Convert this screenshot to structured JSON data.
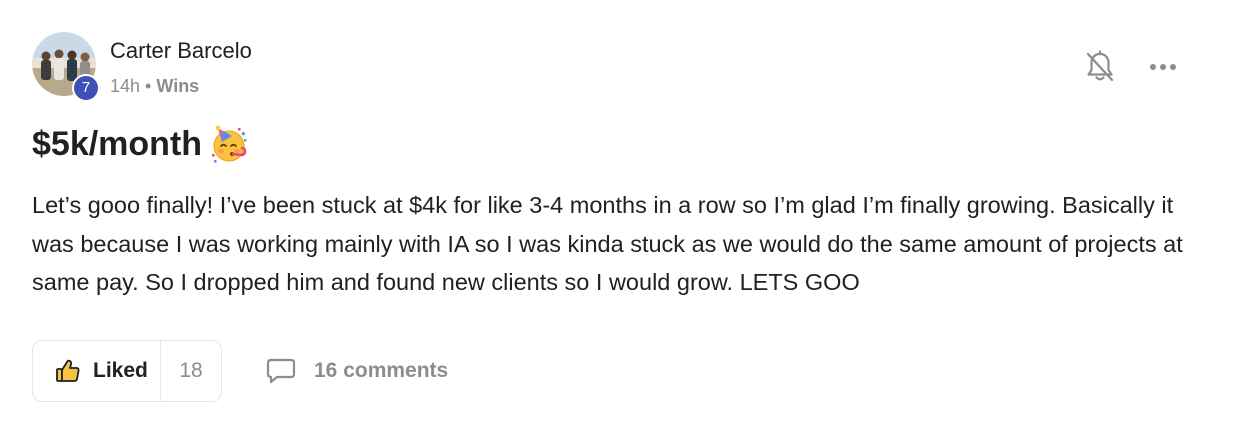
{
  "post": {
    "author": {
      "name": "Carter Barcelo",
      "level": "7"
    },
    "meta": {
      "time": "14h",
      "separator": "•",
      "category": "Wins"
    },
    "title": "$5k/month",
    "title_emoji": "partying-face-icon",
    "body": "Let’s gooo finally! I’ve been stuck at $4k for like 3-4 months in a row so I’m glad I’m finally growing. Basically it was because I was working mainly with IA so I was kinda stuck as we would do the same amount of projects at same pay. So I dropped him and found new clients so I would grow. LETS GOO",
    "actions": {
      "like_label": "Liked",
      "like_count": "18",
      "comments_label": "16 comments"
    }
  },
  "colors": {
    "text": "#202124",
    "muted": "#8a8d91",
    "badge": "#3f51b5",
    "border": "#e4e6e8",
    "like_icon_fill": "#f6c344"
  }
}
